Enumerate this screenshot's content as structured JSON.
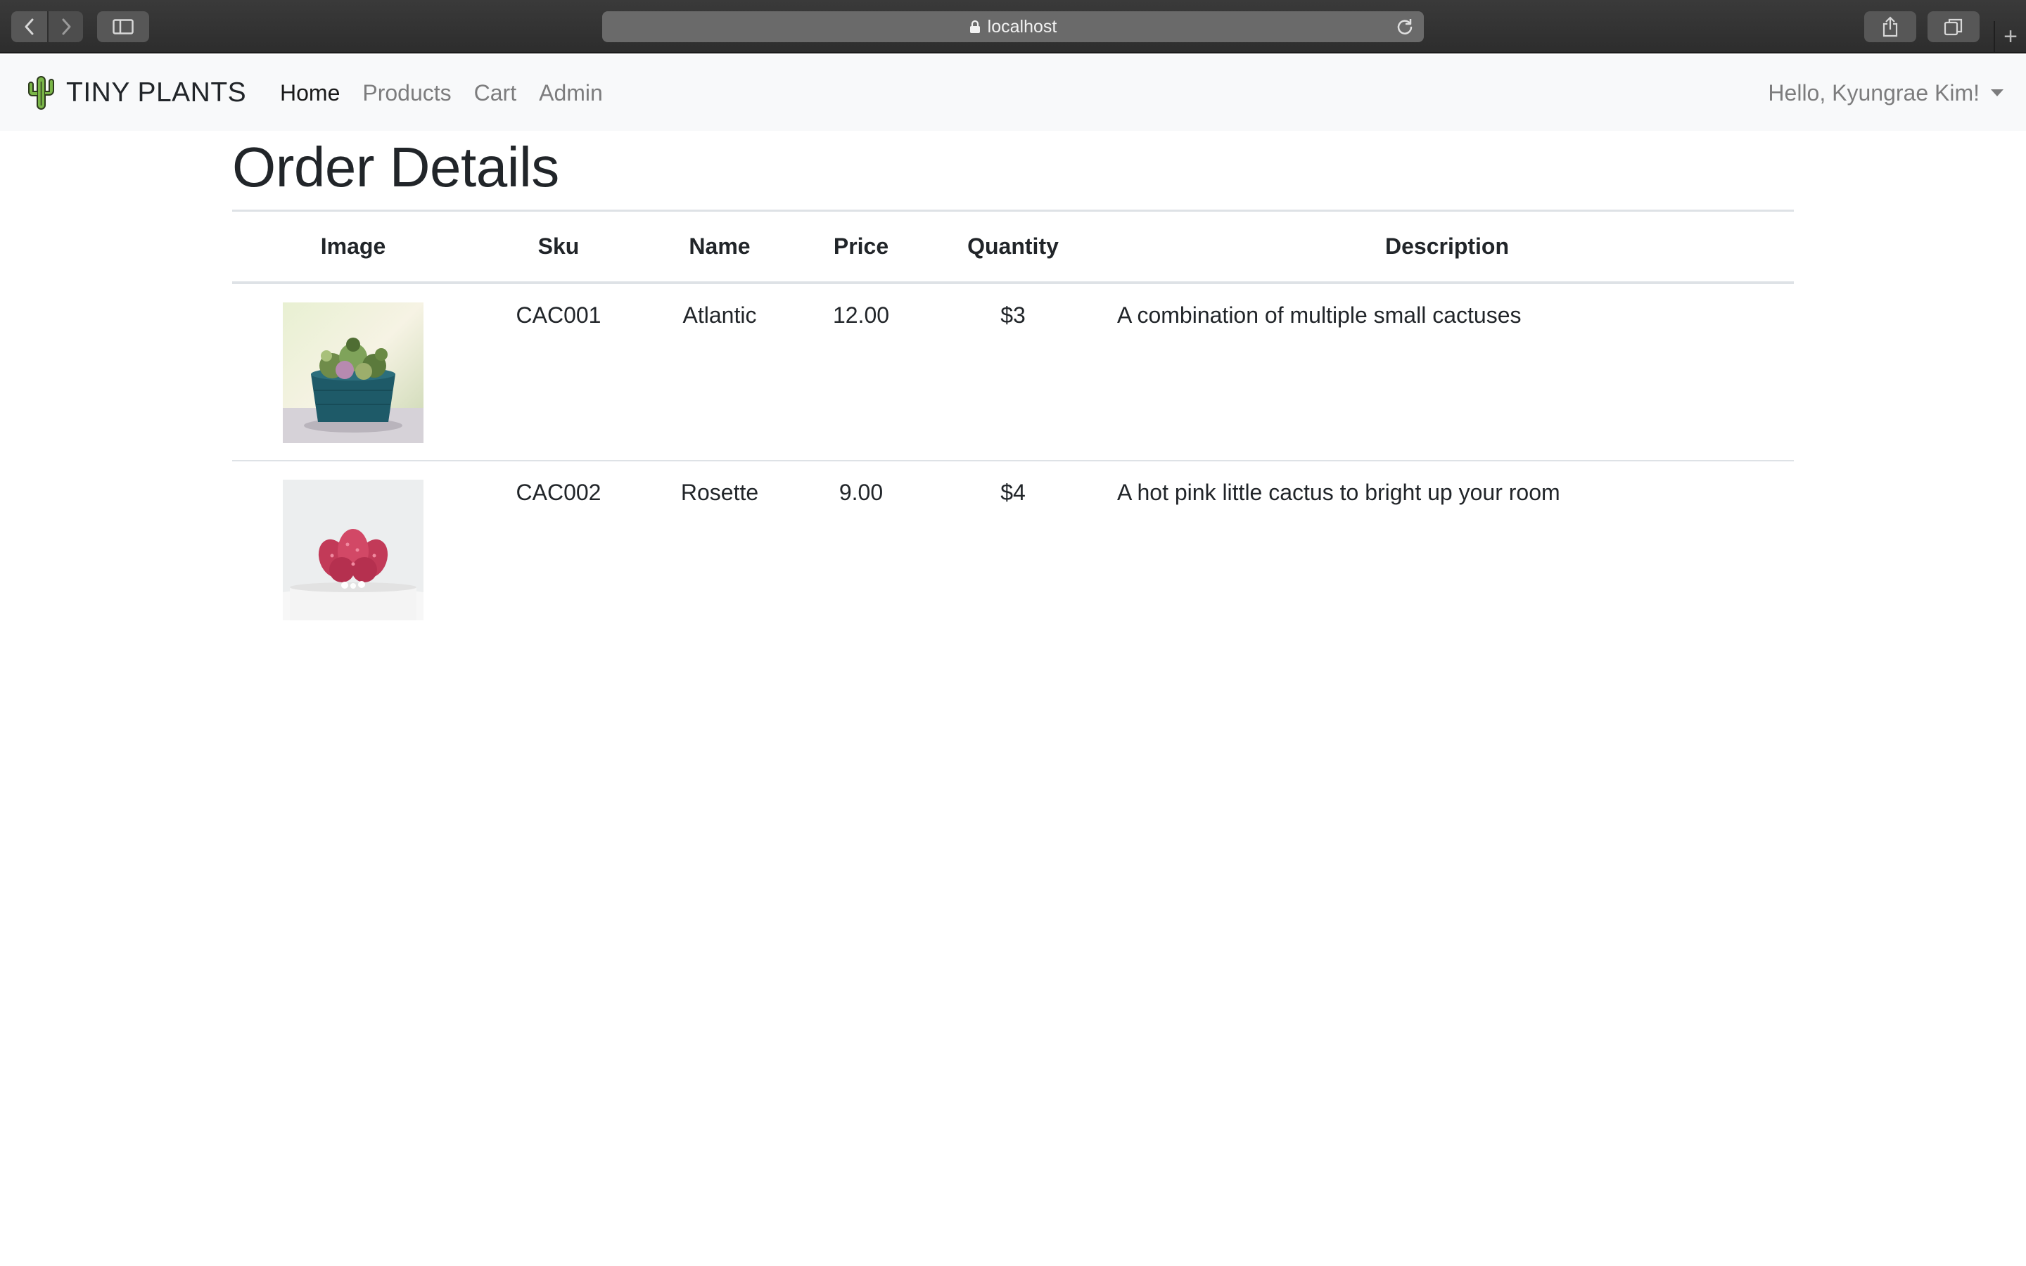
{
  "browser": {
    "url": "localhost"
  },
  "navbar": {
    "brand": "TINY PLANTS",
    "links": [
      {
        "label": "Home",
        "active": true
      },
      {
        "label": "Products",
        "active": false
      },
      {
        "label": "Cart",
        "active": false
      },
      {
        "label": "Admin",
        "active": false
      }
    ],
    "user_greeting": "Hello, Kyungrae Kim!"
  },
  "page": {
    "title": "Order Details"
  },
  "table": {
    "headers": {
      "image": "Image",
      "sku": "Sku",
      "name": "Name",
      "price": "Price",
      "quantity": "Quantity",
      "description": "Description"
    },
    "rows": [
      {
        "image": "succulent-arrangement-in-teal-pot",
        "sku": "CAC001",
        "name": "Atlantic",
        "price": "12.00",
        "quantity": "$3",
        "description": "A combination of multiple small cactuses"
      },
      {
        "image": "pink-cactus-in-white-pot",
        "sku": "CAC002",
        "name": "Rosette",
        "price": "9.00",
        "quantity": "$4",
        "description": "A hot pink little cactus to bright up your room"
      }
    ]
  },
  "colors": {
    "navbar_bg": "#f8f9fa",
    "text": "#212529",
    "border": "#dee2e6",
    "brand_cactus": "#7ab648"
  }
}
